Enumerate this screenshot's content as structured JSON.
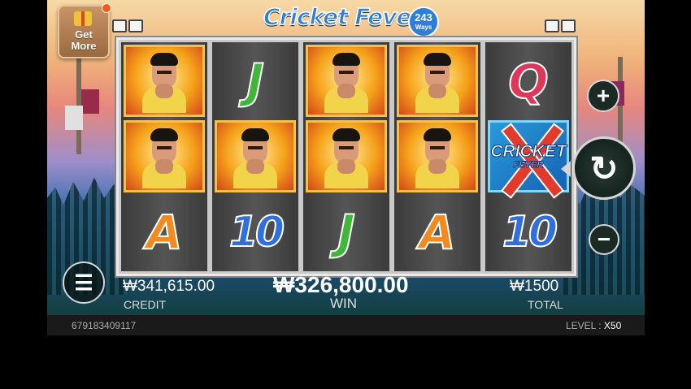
{
  "logo": {
    "title": "Cricket Fever",
    "ways_number": "243",
    "ways_label": "Ways"
  },
  "get_more": {
    "line1": "Get",
    "line2": "More"
  },
  "reels": {
    "columns": [
      [
        "hero",
        "hero",
        "A"
      ],
      [
        "J",
        "hero",
        "10"
      ],
      [
        "hero",
        "hero",
        "J"
      ],
      [
        "hero",
        "hero",
        "A"
      ],
      [
        "Q",
        "wild",
        "10"
      ]
    ],
    "wild_text": "CRICKET",
    "wild_subtext": "FEVER"
  },
  "controls": {
    "plus_icon": "plus-icon",
    "minus_icon": "minus-icon",
    "spin_icon": "spin-refresh-icon",
    "menu_icon": "hamburger-menu-icon"
  },
  "info": {
    "credit_value": "₩341,615.00",
    "credit_label": "CREDIT",
    "win_value": "₩326,800.00",
    "win_label": "WIN",
    "total_value": "₩1500",
    "total_label": "TOTAL"
  },
  "footer": {
    "game_id": "679183409117",
    "level_label": "LEVEL : ",
    "level_value": "X50"
  },
  "colors": {
    "accent": "#2e7dd9",
    "hero_bg": "#f6a21a",
    "frame": "#c9c9c9"
  }
}
